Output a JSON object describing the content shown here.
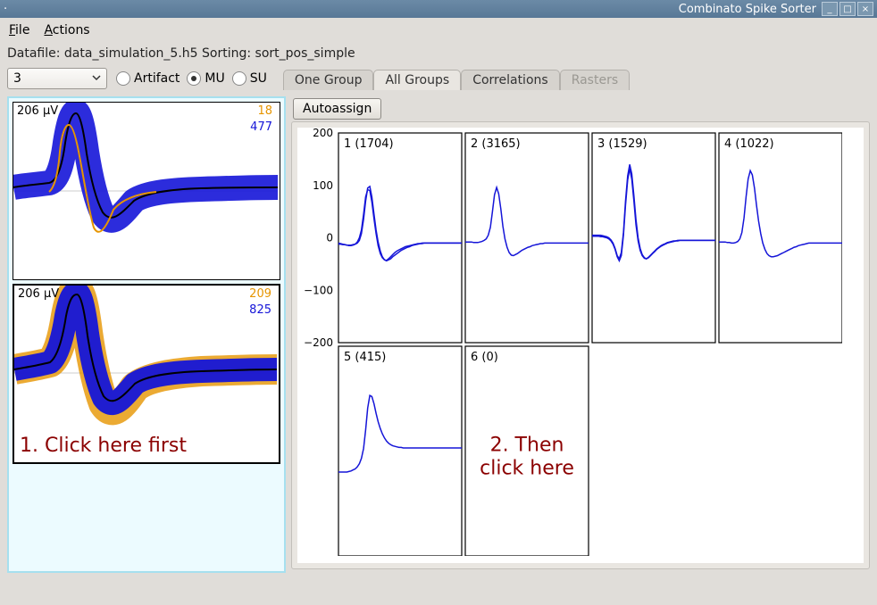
{
  "window": {
    "title": "Combinato Spike Sorter",
    "buttons": {
      "min": "_",
      "max": "□",
      "close": "×"
    }
  },
  "menu": {
    "file": "File",
    "actions": "Actions"
  },
  "status": {
    "text": "Datafile: data_simulation_5.h5 Sorting: sort_pos_simple"
  },
  "combo": {
    "value": "3"
  },
  "radios": {
    "artifact": "Artifact",
    "mu": "MU",
    "su": "SU",
    "checked": "mu"
  },
  "tabs": {
    "one_group": "One Group",
    "all_groups": "All Groups",
    "correlations": "Correlations",
    "rasters": "Rasters",
    "active": "all_groups",
    "disabled": [
      "rasters"
    ]
  },
  "right_toolbar": {
    "autoassign": "Autoassign"
  },
  "left_groups": [
    {
      "uv": "206 µV",
      "orange": "18",
      "blue": "477",
      "selected": false
    },
    {
      "uv": "206 µV",
      "orange": "209",
      "blue": "825",
      "selected": true
    }
  ],
  "instructions": {
    "step1": "1. Click here first",
    "step2": "2. Then click here"
  },
  "chart_data": {
    "type": "line",
    "title": "",
    "xlabel": "",
    "ylabel": "",
    "ylim": [
      -200,
      200
    ],
    "yticks": [
      -200,
      -100,
      0,
      100,
      200
    ],
    "n_samples": 60,
    "panels": [
      {
        "label": "1 (1704)",
        "series": [
          {
            "name": "trace-a",
            "values": [
              -12,
              -12,
              -13,
              -13,
              -14,
              -14,
              -14,
              -13,
              -12,
              -10,
              -5,
              8,
              35,
              70,
              95,
              98,
              78,
              45,
              15,
              -8,
              -25,
              -36,
              -42,
              -44,
              -42,
              -40,
              -36,
              -33,
              -30,
              -27,
              -24,
              -22,
              -20,
              -18,
              -17,
              -15,
              -14,
              -13,
              -12,
              -11,
              -11,
              -10,
              -10,
              -10,
              -10,
              -10,
              -10,
              -10,
              -10,
              -10,
              -10,
              -10,
              -10,
              -10,
              -10,
              -10,
              -10,
              -10,
              -10,
              -10
            ]
          },
          {
            "name": "trace-b",
            "values": [
              -10,
              -11,
              -12,
              -13,
              -14,
              -15,
              -15,
              -14,
              -12,
              -8,
              0,
              15,
              45,
              78,
              92,
              90,
              68,
              36,
              8,
              -15,
              -30,
              -38,
              -42,
              -43,
              -40,
              -36,
              -32,
              -28,
              -25,
              -23,
              -21,
              -19,
              -17,
              -16,
              -15,
              -14,
              -13,
              -12,
              -11,
              -11,
              -10,
              -10,
              -10,
              -10,
              -10,
              -10,
              -10,
              -10,
              -10,
              -10,
              -10,
              -10,
              -10,
              -10,
              -10,
              -10,
              -10,
              -10,
              -10,
              -10
            ]
          }
        ]
      },
      {
        "label": "2 (3165)",
        "series": [
          {
            "name": "trace-a",
            "values": [
              -8,
              -8,
              -8,
              -8,
              -9,
              -9,
              -9,
              -8,
              -7,
              -5,
              -2,
              5,
              20,
              50,
              82,
              96,
              84,
              55,
              22,
              -2,
              -18,
              -28,
              -33,
              -34,
              -32,
              -30,
              -27,
              -24,
              -22,
              -20,
              -18,
              -17,
              -15,
              -14,
              -13,
              -12,
              -11,
              -11,
              -10,
              -10,
              -10,
              -10,
              -10,
              -10,
              -10,
              -10,
              -10,
              -10,
              -10,
              -10,
              -10,
              -10,
              -10,
              -10,
              -10,
              -10,
              -10,
              -10,
              -10,
              -10
            ]
          }
        ]
      },
      {
        "label": "3 (1529)",
        "series": [
          {
            "name": "trace-a",
            "values": [
              5,
              5,
              5,
              5,
              5,
              4,
              3,
              2,
              0,
              -4,
              -10,
              -20,
              -34,
              -40,
              -28,
              10,
              70,
              118,
              140,
              122,
              80,
              35,
              0,
              -20,
              -32,
              -38,
              -40,
              -38,
              -34,
              -30,
              -26,
              -22,
              -19,
              -16,
              -14,
              -12,
              -10,
              -9,
              -8,
              -7,
              -6,
              -6,
              -5,
              -5,
              -5,
              -5,
              -5,
              -5,
              -5,
              -5,
              -5,
              -5,
              -5,
              -5,
              -5,
              -5,
              -5,
              -5,
              -5,
              -5
            ]
          },
          {
            "name": "trace-b",
            "values": [
              3,
              3,
              3,
              3,
              2,
              2,
              1,
              0,
              -2,
              -6,
              -12,
              -22,
              -36,
              -44,
              -34,
              5,
              62,
              110,
              132,
              112,
              70,
              25,
              -6,
              -24,
              -34,
              -39,
              -40,
              -37,
              -33,
              -29,
              -25,
              -21,
              -18,
              -15,
              -13,
              -11,
              -9,
              -8,
              -7,
              -6,
              -6,
              -5,
              -5,
              -5,
              -5,
              -5,
              -5,
              -5,
              -5,
              -5,
              -5,
              -5,
              -5,
              -5,
              -5,
              -5,
              -5,
              -5,
              -5,
              -5
            ]
          }
        ]
      },
      {
        "label": "4 (1022)",
        "series": [
          {
            "name": "trace-a",
            "values": [
              -8,
              -8,
              -8,
              -8,
              -9,
              -9,
              -10,
              -10,
              -9,
              -7,
              -2,
              10,
              38,
              78,
              112,
              128,
              120,
              95,
              62,
              32,
              8,
              -10,
              -22,
              -30,
              -34,
              -36,
              -36,
              -35,
              -34,
              -32,
              -30,
              -28,
              -26,
              -24,
              -22,
              -20,
              -18,
              -17,
              -15,
              -14,
              -13,
              -12,
              -11,
              -10,
              -10,
              -10,
              -10,
              -10,
              -10,
              -10,
              -10,
              -10,
              -10,
              -10,
              -10,
              -10,
              -10,
              -10,
              -10,
              -10
            ]
          }
        ]
      },
      {
        "label": "5 (415)",
        "series": [
          {
            "name": "trace-a",
            "values": [
              -40,
              -40,
              -40,
              -40,
              -40,
              -39,
              -38,
              -36,
              -34,
              -30,
              -24,
              -14,
              5,
              40,
              82,
              106,
              104,
              90,
              72,
              56,
              43,
              33,
              25,
              19,
              15,
              12,
              10,
              9,
              8,
              7,
              7,
              6,
              6,
              6,
              6,
              6,
              6,
              6,
              6,
              6,
              6,
              6,
              6,
              6,
              6,
              6,
              6,
              6,
              6,
              6,
              6,
              6,
              6,
              6,
              6,
              6,
              6,
              6,
              6,
              6
            ]
          }
        ]
      },
      {
        "label": "6 (0)",
        "series": [],
        "annotation": "2. Then click here"
      }
    ]
  }
}
